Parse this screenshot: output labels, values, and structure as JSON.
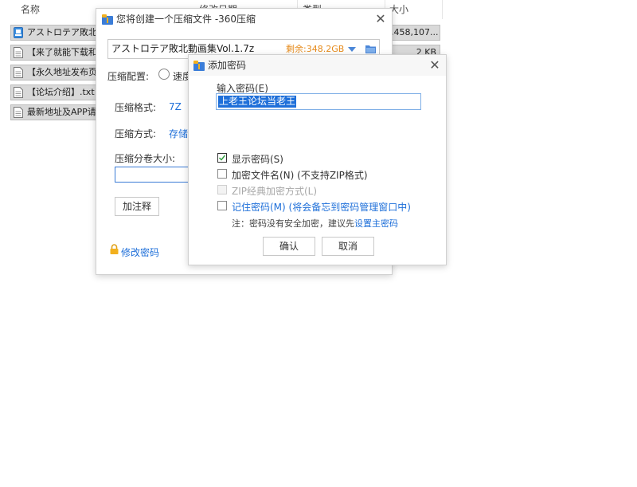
{
  "explorer": {
    "columns": {
      "name": "名称",
      "date": "修改日期",
      "type": "类型",
      "size": "大小"
    },
    "files": [
      {
        "name": "アストロテア敗北",
        "size": "3,458,107...",
        "icon": "archive-icon"
      },
      {
        "name": "【来了就能下载和",
        "size": "2 KB",
        "icon": "document-icon"
      },
      {
        "name": "【永久地址发布页",
        "size": "",
        "icon": "document-icon"
      },
      {
        "name": "【论坛介绍】.txt",
        "size": "",
        "icon": "document-icon"
      },
      {
        "name": "最新地址及APP请",
        "size": "",
        "icon": "document-icon"
      }
    ]
  },
  "compress_dialog": {
    "title": "您将创建一个压缩文件 -360压缩",
    "filename": "アストロテア敗北動画集Vol.1.7z",
    "free_space": "剩余:348.2GB",
    "config_label": "压缩配置:",
    "config_option": "速度",
    "format_label": "压缩格式:",
    "format_value": "7Z",
    "method_label": "压缩方式:",
    "method_value": "存储",
    "split_label": "压缩分卷大小:",
    "comment_button": "加注释",
    "change_password": "修改密码",
    "colors": {
      "accent": "#1e6fd9",
      "free_space": "#e68a1a"
    }
  },
  "password_dialog": {
    "title": "添加密码",
    "input_label": "输入密码(E)",
    "password_value": "上老王论坛当老王",
    "options": {
      "show_password": "显示密码(S)",
      "encrypt_names": "加密文件名(N) (不支持ZIP格式)",
      "zip_classic": "ZIP经典加密方式(L)",
      "remember": "记住密码(M) (将会备忘到密码管理窗口中)"
    },
    "note_prefix": "注：密码没有安全加密，建议先",
    "note_link": "设置主密码",
    "ok_button": "确认",
    "cancel_button": "取消"
  }
}
